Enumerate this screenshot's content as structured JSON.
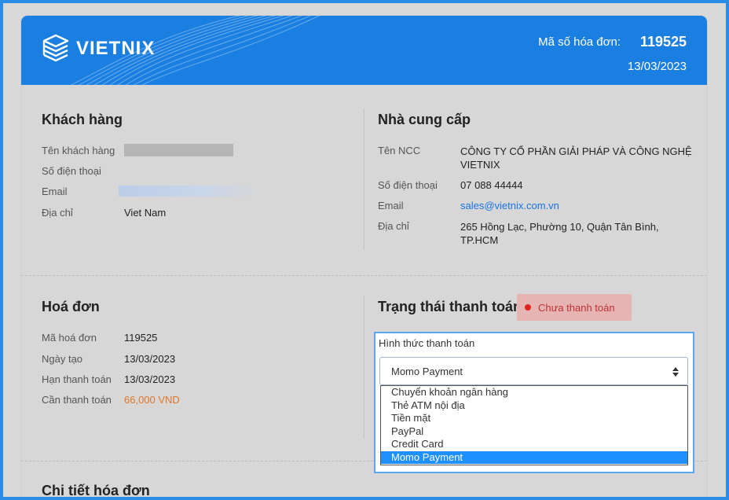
{
  "header": {
    "logo_text": "VIETNIX",
    "invoice_number_label": "Mã số hóa đơn:",
    "invoice_number": "119525",
    "invoice_date": "13/03/2023"
  },
  "customer": {
    "title": "Khách hàng",
    "fields": [
      {
        "label": "Tên khách hàng",
        "value": ""
      },
      {
        "label": "Số điện thoại",
        "value": ""
      },
      {
        "label": "Email",
        "value": ""
      },
      {
        "label": "Địa chỉ",
        "value": "Viet Nam"
      }
    ]
  },
  "supplier": {
    "title": "Nhà cung cấp",
    "fields": [
      {
        "label": "Tên NCC",
        "value": "CÔNG TY CỔ PHẦN GIẢI PHÁP VÀ CÔNG NGHỆ VIETNIX"
      },
      {
        "label": "Số điện thoại",
        "value": "07 088 44444"
      },
      {
        "label": "Email",
        "value": "sales@vietnix.com.vn"
      },
      {
        "label": "Địa chỉ",
        "value": "265 Hồng Lạc, Phường 10, Quận Tân Bình, TP.HCM"
      }
    ]
  },
  "invoice": {
    "title": "Hoá đơn",
    "fields": [
      {
        "label": "Mã hoá đơn",
        "value": "119525"
      },
      {
        "label": "Ngày tạo",
        "value": "13/03/2023"
      },
      {
        "label": "Hạn thanh toán",
        "value": "13/03/2023"
      },
      {
        "label": "Cần thanh toán",
        "value": "66,000 VND"
      }
    ]
  },
  "payment": {
    "title": "Trạng thái thanh toán",
    "status": "Chưa thanh toán",
    "method_label": "Hình thức thanh toán",
    "selected": "Momo Payment",
    "options": [
      "Chuyển khoản ngân hàng",
      "Thẻ ATM nội địa",
      "Tiền mặt",
      "PayPal",
      "Credit Card",
      "Momo Payment"
    ]
  },
  "details": {
    "title": "Chi tiết hóa đơn"
  },
  "colors": {
    "brand_blue": "#1a7fe0",
    "amount_orange": "#e0772a",
    "status_red": "#d22222",
    "selected_option": "#1e90ff"
  }
}
